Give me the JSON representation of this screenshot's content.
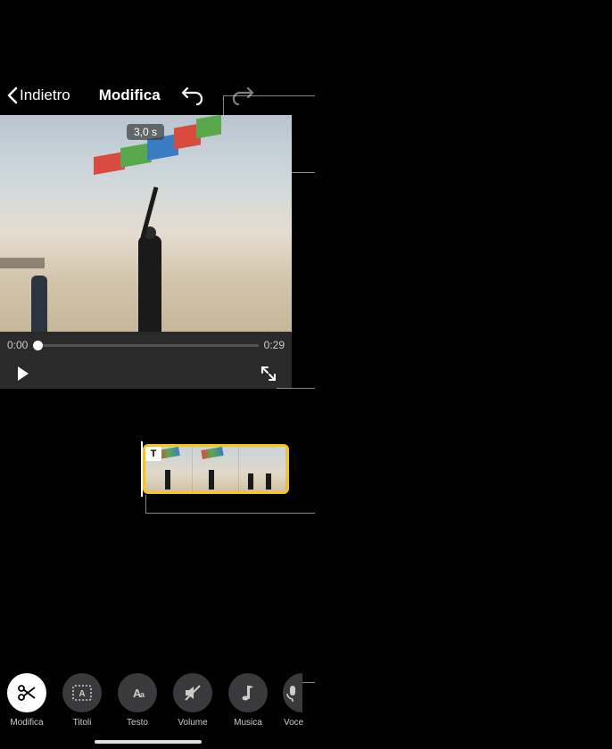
{
  "header": {
    "back_label": "Indietro",
    "title": "Modifica"
  },
  "video": {
    "duration_badge": "3,0 s",
    "current_time": "0:00",
    "total_time": "0:29"
  },
  "timeline": {
    "text_badge": "T"
  },
  "toolbar": {
    "items": [
      {
        "label": "Modifica"
      },
      {
        "label": "Titoli"
      },
      {
        "label": "Testo"
      },
      {
        "label": "Volume"
      },
      {
        "label": "Musica"
      },
      {
        "label": "Voce"
      }
    ]
  }
}
